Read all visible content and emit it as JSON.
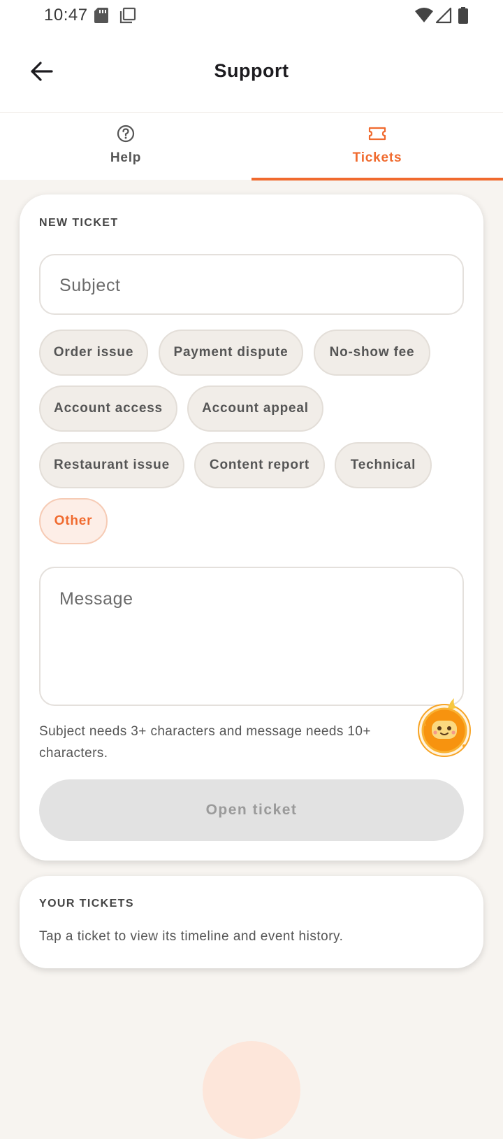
{
  "status_bar": {
    "time": "10:47",
    "icons": [
      "sd-card-icon",
      "screenshot-icon",
      "wifi-icon",
      "signal-icon",
      "battery-icon"
    ]
  },
  "app_bar": {
    "title": "Support",
    "back_icon": "arrow-left-icon"
  },
  "tabs": [
    {
      "label": "Help",
      "icon": "help-circle-icon",
      "active": false
    },
    {
      "label": "Tickets",
      "icon": "ticket-icon",
      "active": true
    }
  ],
  "new_ticket": {
    "section_title": "NEW TICKET",
    "subject_placeholder": "Subject",
    "categories": [
      "Order issue",
      "Payment dispute",
      "No-show fee",
      "Account access",
      "Account appeal",
      "Restaurant issue",
      "Content report",
      "Technical",
      "Other"
    ],
    "selected_category": "Other",
    "message_placeholder": "Message",
    "hint": "Subject needs 3+ characters and message needs 10+ characters.",
    "submit_label": "Open ticket"
  },
  "your_tickets": {
    "section_title": "YOUR TICKETS",
    "empty_text": "Tap a ticket to view its timeline and event history."
  },
  "colors": {
    "accent": "#f06a2e",
    "background": "#f7f4f0",
    "chip": "#f1ede8",
    "chip_selected": "#fdeee7",
    "disabled_button": "#e2e2e2"
  }
}
